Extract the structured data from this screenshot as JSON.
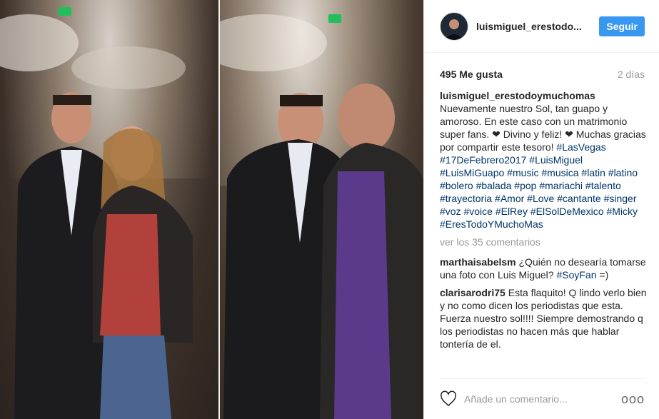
{
  "post": {
    "photo_alt": "",
    "header": {
      "username": "luismiguel_erestodo...",
      "follow_label": "Seguir"
    },
    "stats": {
      "likes": "495 Me gusta",
      "time_ago": "2 días"
    },
    "caption": {
      "author": "luismiguel_erestodoymuchomas",
      "text": "Nuevamente nuestro Sol, tan guapo y amoroso. En este caso con un matrimonio super fans. ❤ Divino y feliz! ❤ Muchas gracias por compartir este tesoro!",
      "hashtags": "#LasVegas #17DeFebrero2017 #LuisMiguel #LuisMiGuapo #music #musica #latin #latino #bolero #balada #pop #mariachi #talento #trayectoria #Amor #Love #cantante #singer #voz #voice #ElRey #ElSolDeMexico #Micky #EresTodoYMuchoMas"
    },
    "view_comments": "ver los 35 comentarios",
    "comments": [
      {
        "user": "marthaisabelsm",
        "text": "¿Quién no desearía tomarse una foto con Luis Miguel?",
        "tag": "#SoyFan",
        "tail": "=)"
      },
      {
        "user": "clarisarodri75",
        "text": "Esta flaquito! Q lindo verlo bien y no como dicen los periodistas que esta. Fuerza nuestro sol!!!! Siempre demostrando q los periodistas no hacen más que hablar tontería de el.",
        "tag": "",
        "tail": ""
      }
    ],
    "footer": {
      "placeholder": "Añade un comentario...",
      "more": "ooo"
    }
  },
  "colors": {
    "accent": "#3897f0",
    "hashtag": "#003569",
    "muted": "#999999"
  }
}
